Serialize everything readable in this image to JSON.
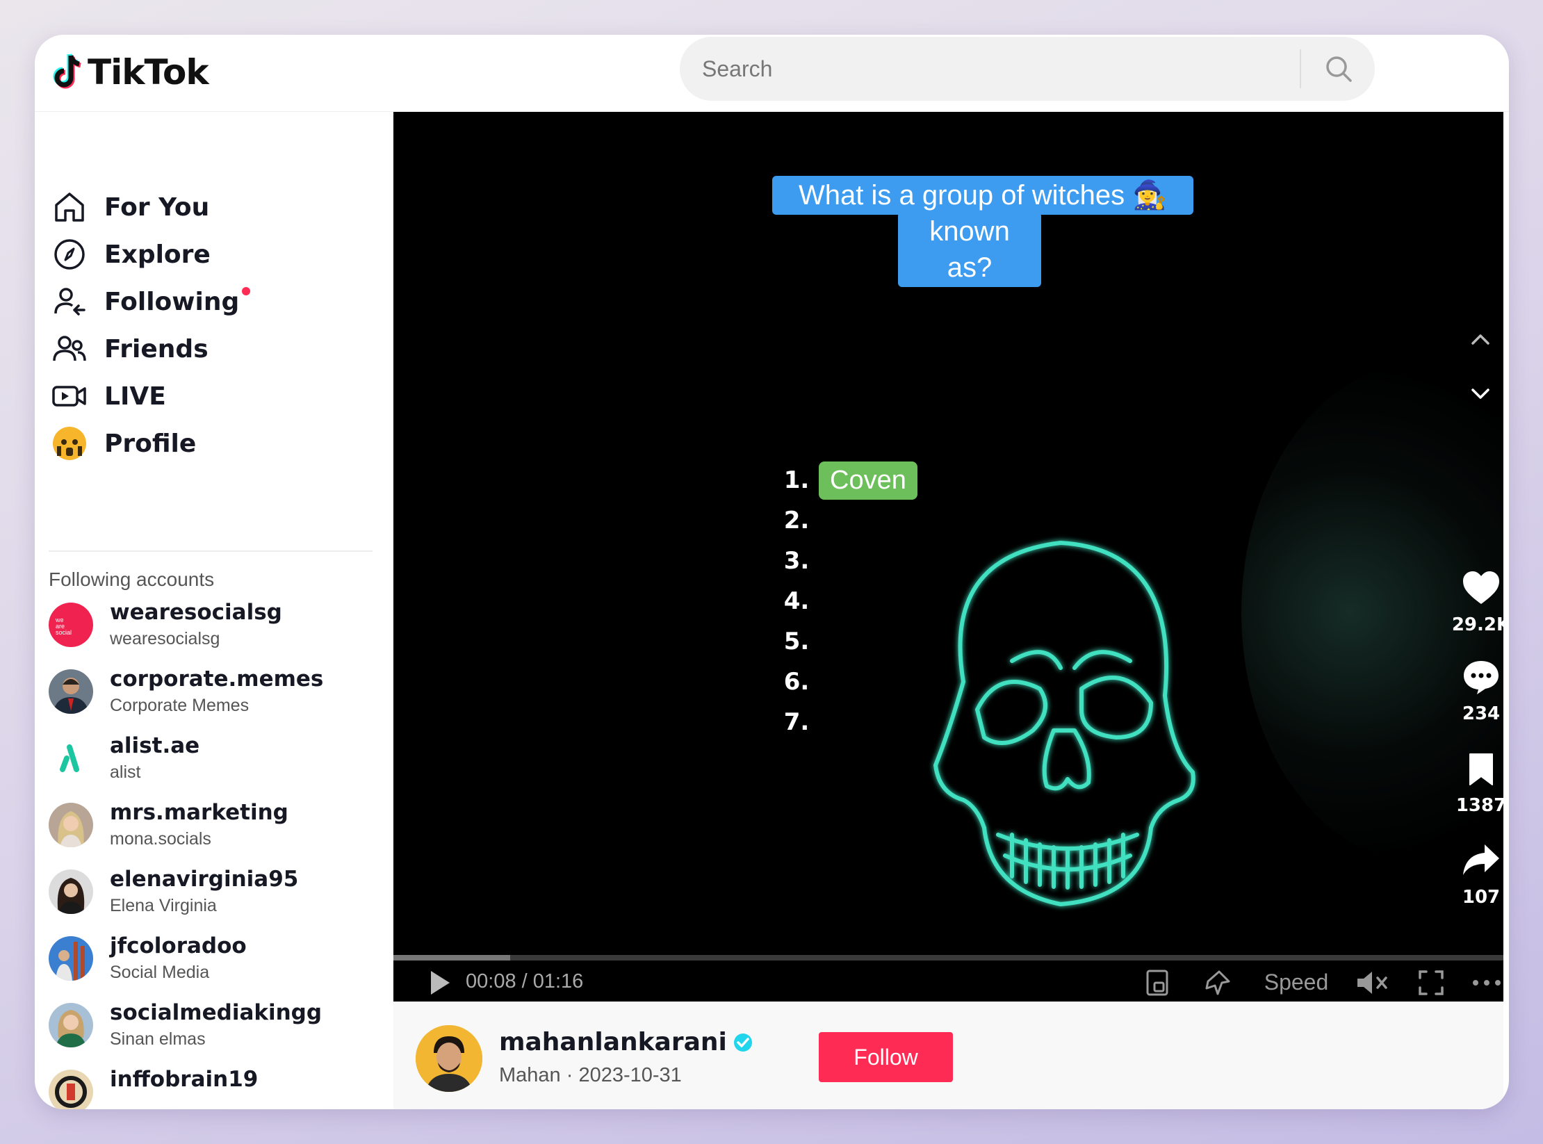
{
  "app": {
    "name": "TikTok"
  },
  "search": {
    "placeholder": "Search"
  },
  "nav": [
    {
      "label": "For You",
      "icon": "home-icon"
    },
    {
      "label": "Explore",
      "icon": "compass-icon"
    },
    {
      "label": "Following",
      "icon": "following-icon",
      "has_dot": true
    },
    {
      "label": "Friends",
      "icon": "friends-icon"
    },
    {
      "label": "LIVE",
      "icon": "live-icon"
    },
    {
      "label": "Profile",
      "icon": "profile-avatar"
    }
  ],
  "following": {
    "title": "Following accounts",
    "accounts": [
      {
        "username": "wearesocialsg",
        "nickname": "wearesocialsg"
      },
      {
        "username": "corporate.memes",
        "nickname": "Corporate Memes"
      },
      {
        "username": "alist.ae",
        "nickname": "alist"
      },
      {
        "username": "mrs.marketing",
        "nickname": "mona.socials"
      },
      {
        "username": "elenavirginia95",
        "nickname": "Elena Virginia"
      },
      {
        "username": "jfcoloradoo",
        "nickname": "Social Media"
      },
      {
        "username": "socialmediakingg",
        "nickname": "Sinan elmas"
      },
      {
        "username": "inffobrain19",
        "nickname": ""
      }
    ]
  },
  "video": {
    "question_line1": "What is a group of witches 🧙‍♀️",
    "question_line2": "known as?",
    "answers": [
      {
        "num": "1.",
        "text": "Coven"
      },
      {
        "num": "2.",
        "text": ""
      },
      {
        "num": "3.",
        "text": ""
      },
      {
        "num": "4.",
        "text": ""
      },
      {
        "num": "5.",
        "text": ""
      },
      {
        "num": "6.",
        "text": ""
      },
      {
        "num": "7.",
        "text": ""
      }
    ],
    "likes": "29.2K",
    "comments": "234",
    "saves": "1387",
    "shares": "107",
    "progress": 0.105,
    "time": "00:08 / 01:16",
    "speed_label": "Speed"
  },
  "author": {
    "username": "mahanlankarani",
    "verified": true,
    "nickname": "Mahan",
    "date": "2023-10-31",
    "subline": "Mahan · 2023-10-31",
    "follow_label": "Follow"
  },
  "colors": {
    "brand_red": "#fe2c55",
    "question_bg": "#3d9cf0",
    "answer_bg": "#6cbf5a",
    "skull_glow": "#3fe0c0",
    "verified": "#20d5ec"
  }
}
